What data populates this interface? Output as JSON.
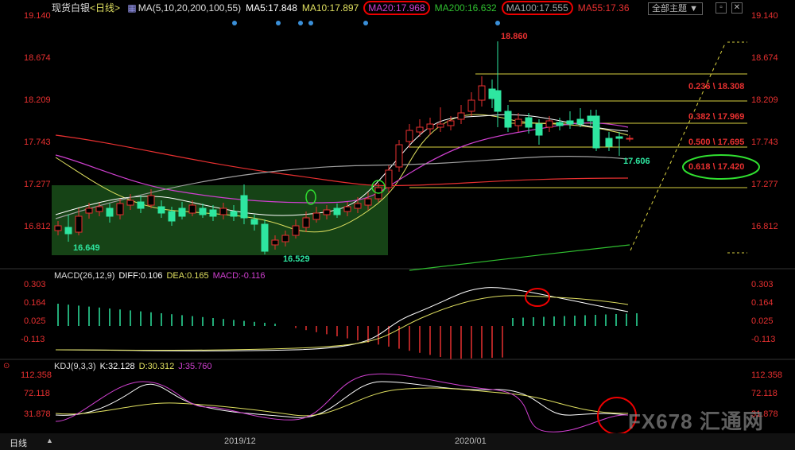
{
  "header": {
    "symbol": "现货白银",
    "period": "<日线>",
    "ma_icon": "ma-indicator-icon",
    "ma_params": "MA(5,10,20,200,100,55)",
    "ma5": "MA5:17.848",
    "ma10": "MA10:17.897",
    "ma20": "MA20:17.968",
    "ma200": "MA200:16.632",
    "ma100": "MA100:17.555",
    "ma55": "MA55:17.36",
    "theme_label": "全部主题",
    "theme_arrow": "▼",
    "btn_min": "▫",
    "btn_close": "✕"
  },
  "main_axis": [
    "19.140",
    "18.674",
    "18.209",
    "17.743",
    "17.277",
    "16.812"
  ],
  "annotations": {
    "high": "18.860",
    "last": "17.606",
    "low1": "16.649",
    "low2": "16.529"
  },
  "fib": [
    {
      "label": "0.236 \\ 18.308"
    },
    {
      "label": "0.382 \\ 17.969"
    },
    {
      "label": "0.500 \\ 17.695"
    },
    {
      "label": "0.618 \\ 17.420"
    }
  ],
  "macd": {
    "title": "MACD(26,12,9)",
    "diff": "DIFF:0.106",
    "dea": "DEA:0.165",
    "macd": "MACD:-0.116",
    "axis": [
      "0.303",
      "0.164",
      "0.025",
      "-0.113"
    ]
  },
  "kdj": {
    "title": "KDJ(9,3,3)",
    "k": "K:32.128",
    "d": "D:30.312",
    "j": "J:35.760",
    "axis": [
      "112.358",
      "72.118",
      "31.878"
    ]
  },
  "footer": {
    "period_tab": "日线",
    "period_arrow": "▲",
    "date1": "2019/12",
    "date2": "2020/01"
  },
  "watermark": "FX678 汇通网",
  "chart_data": {
    "type": "candlestick",
    "ylim": [
      16.5,
      19.2
    ],
    "colors": {
      "up": "#e83030",
      "down": "#2ee6a0",
      "ma5": "#ffffff",
      "ma10": "#e0e060",
      "ma20": "#d040d0",
      "ma200": "#30c030",
      "ma100": "#a0a0a0",
      "ma55": "#e83030"
    }
  }
}
